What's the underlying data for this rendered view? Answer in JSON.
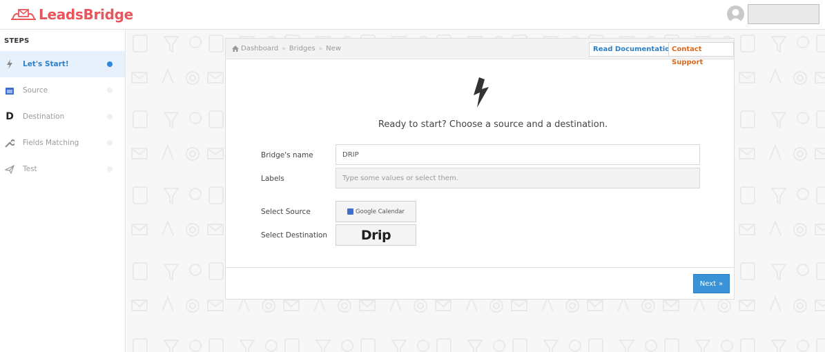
{
  "app": {
    "brand": "LeadsBridge"
  },
  "sidebar": {
    "title": "STEPS",
    "items": [
      {
        "label": "Let's Start!",
        "icon": "bolt-icon",
        "active": true
      },
      {
        "label": "Source",
        "icon": "calendar-icon",
        "active": false
      },
      {
        "label": "Destination",
        "icon": "letter-d-icon",
        "active": false
      },
      {
        "label": "Fields Matching",
        "icon": "wrench-icon",
        "active": false
      },
      {
        "label": "Test",
        "icon": "paper-plane-icon",
        "active": false
      }
    ]
  },
  "breadcrumb": {
    "items": [
      "Dashboard",
      "Bridges",
      "New"
    ],
    "separator": "»"
  },
  "header_actions": {
    "docs": "Read Documentation",
    "support": "Contact Support"
  },
  "main": {
    "headline": "Ready to start? Choose a source and a destination.",
    "bridge_name": {
      "label": "Bridge's name",
      "value": "DRIP"
    },
    "labels": {
      "label": "Labels",
      "placeholder": "Type some values or select them."
    },
    "source": {
      "label": "Select Source",
      "name": "Google Calendar"
    },
    "destination": {
      "label": "Select Destination",
      "name": "Drip"
    }
  },
  "next_button": {
    "label": "Next",
    "chevron": "»"
  },
  "colors": {
    "brand": "#e8555a",
    "accent": "#3a93d6",
    "support": "#d9691e"
  }
}
